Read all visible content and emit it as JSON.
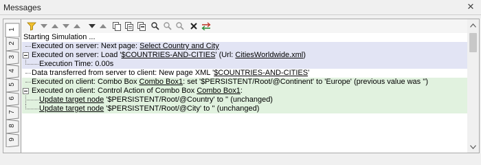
{
  "window": {
    "title": "Messages",
    "close_glyph": "✕"
  },
  "tabs": [
    "1",
    "2",
    "3",
    "4",
    "5",
    "6",
    "7",
    "8",
    "9"
  ],
  "toolbar": {
    "icons": [
      "filter-icon",
      "next-warning-icon",
      "prev-warning-icon",
      "next-error-icon",
      "prev-error-icon",
      "next-icon",
      "prev-icon",
      "copy-icon",
      "copy-all-icon",
      "copy-selected-icon",
      "find-icon",
      "find-next-icon",
      "find-prev-icon",
      "clear-icon",
      "wrap-icon"
    ]
  },
  "messages": [
    {
      "text": "Starting Simulation ..."
    },
    {
      "prefix": "Executed on server: Next page: ",
      "link": "Select Country and City",
      "suffix": ""
    },
    {
      "prefix": "Executed on server: Load '",
      "link": "$COUNTRIES-AND-CITIES",
      "mid": "' (Url: ",
      "link2": "CitiesWorldwide.xml",
      "suffix": ")"
    },
    {
      "text": "Execution Time: 0.00s"
    },
    {
      "prefix": "Data transferred from server to client: New page XML '",
      "link": "$COUNTRIES-AND-CITIES",
      "suffix": "'"
    },
    {
      "prefix": "Executed on client: Combo Box ",
      "link": "Combo Box1",
      "suffix": ": set '$PERSISTENT/Root/@Continent' to 'Europe' (previous value was '')"
    },
    {
      "prefix": "Executed on client: Control Action of Combo Box ",
      "link": "Combo Box1",
      "suffix": ":"
    },
    {
      "link": "Update target node",
      "suffix": " '$PERSISTENT/Root/@Country' to '' (unchanged)"
    },
    {
      "link": "Update target node",
      "suffix": " '$PERSISTENT/Root/@City' to '' (unchanged)"
    }
  ],
  "colors": {
    "server_band": "#e2e4f4",
    "client_band": "#e1f2df"
  }
}
